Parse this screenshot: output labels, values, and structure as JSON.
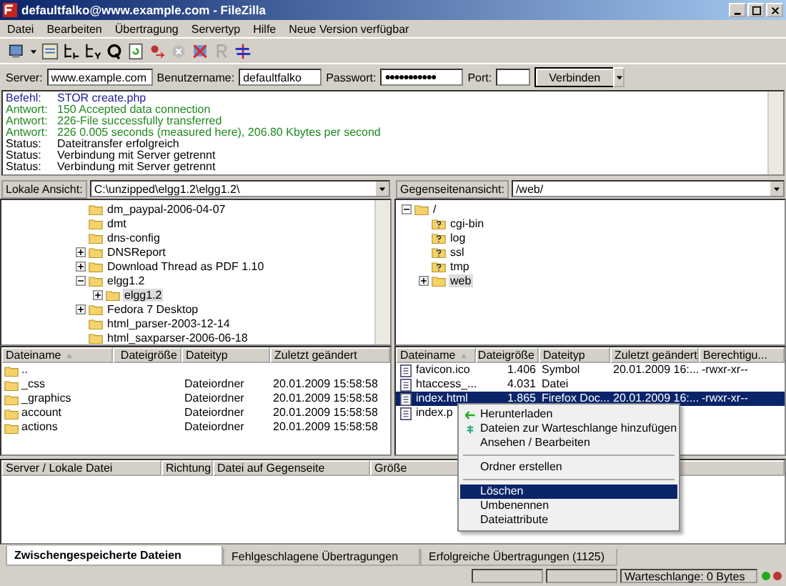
{
  "window": {
    "title": "defaultfalko@www.example.com - FileZilla"
  },
  "menu": [
    "Datei",
    "Bearbeiten",
    "Übertragung",
    "Servertyp",
    "Hilfe",
    "Neue Version verfügbar"
  ],
  "quickconnect": {
    "server_label": "Server:",
    "server": "www.example.com",
    "user_label": "Benutzername:",
    "user": "defaultfalko",
    "password_label": "Passwort:",
    "password": "●●●●●●●●●●●",
    "port_label": "Port:",
    "connect": "Verbinden"
  },
  "log": [
    {
      "kind": "command",
      "label": "Befehl:",
      "text": "STOR create.php"
    },
    {
      "kind": "response",
      "label": "Antwort:",
      "text": "150 Accepted data connection"
    },
    {
      "kind": "response",
      "label": "Antwort:",
      "text": "226-File successfully transferred"
    },
    {
      "kind": "response",
      "label": "Antwort:",
      "text": "226 0.005 seconds (measured here), 206.80 Kbytes per second"
    },
    {
      "kind": "status",
      "label": "Status:",
      "text": "Dateitransfer erfolgreich"
    },
    {
      "kind": "status",
      "label": "Status:",
      "text": "Verbindung mit Server getrennt"
    },
    {
      "kind": "status",
      "label": "Status:",
      "text": "Verbindung mit Server getrennt"
    }
  ],
  "local": {
    "path_label": "Lokale Ansicht:",
    "path": "C:\\unzipped\\elgg1.2\\elgg1.2\\",
    "tree": [
      {
        "name": "dm_paypal-2006-04-07",
        "kind": "folder",
        "selected": false
      },
      {
        "name": "dmt",
        "kind": "folder",
        "selected": false
      },
      {
        "name": "dns-config",
        "kind": "folder",
        "selected": false
      },
      {
        "name": "DNSReport",
        "kind": "folder",
        "selected": false,
        "expanded": false
      },
      {
        "name": "Download Thread as PDF 1.10",
        "kind": "folder",
        "selected": false,
        "expanded": false
      },
      {
        "name": "elgg1.2",
        "kind": "folder",
        "selected": false,
        "expanded": true,
        "children": [
          {
            "name": "elgg1.2",
            "kind": "folder",
            "selected": true,
            "expanded": false
          }
        ]
      },
      {
        "name": "Fedora 7 Desktop",
        "kind": "folder",
        "selected": false,
        "expanded": false
      },
      {
        "name": "html_parser-2003-12-14",
        "kind": "folder",
        "selected": false
      },
      {
        "name": "html_saxparser-2006-06-18",
        "kind": "folder",
        "selected": false
      }
    ],
    "columns": [
      "Dateiname",
      "Dateigröße",
      "Dateityp",
      "Zuletzt geändert"
    ],
    "rows": [
      {
        "name": "..",
        "size": "",
        "type": "",
        "modified": ""
      },
      {
        "name": "_css",
        "size": "",
        "type": "Dateiordner",
        "modified": "20.01.2009 15:58:58"
      },
      {
        "name": "_graphics",
        "size": "",
        "type": "Dateiordner",
        "modified": "20.01.2009 15:58:58"
      },
      {
        "name": "account",
        "size": "",
        "type": "Dateiordner",
        "modified": "20.01.2009 15:58:58"
      },
      {
        "name": "actions",
        "size": "",
        "type": "Dateiordner",
        "modified": "20.01.2009 15:58:58"
      }
    ]
  },
  "remote": {
    "path_label": "Gegenseitenansicht:",
    "path": "/web/",
    "tree": [
      {
        "name": "/",
        "kind": "folder",
        "selected": false,
        "expanded": true,
        "children": [
          {
            "name": "cgi-bin",
            "kind": "unknown",
            "selected": false
          },
          {
            "name": "log",
            "kind": "unknown",
            "selected": false
          },
          {
            "name": "ssl",
            "kind": "unknown",
            "selected": false
          },
          {
            "name": "tmp",
            "kind": "unknown",
            "selected": false
          },
          {
            "name": "web",
            "kind": "folder",
            "selected": true,
            "expanded": false
          }
        ]
      }
    ],
    "columns": [
      "Dateiname",
      "Dateigröße",
      "Dateityp",
      "Zuletzt geändert",
      "Berechtigu..."
    ],
    "rows": [
      {
        "name": "favicon.ico",
        "size": "1.406",
        "type": "Symbol",
        "modified": "20.01.2009 16:...",
        "perms": "-rwxr-xr--",
        "selected": false
      },
      {
        "name": "htaccess_...",
        "size": "4.031",
        "type": "Datei",
        "modified": "",
        "perms": "",
        "selected": false
      },
      {
        "name": "index.html",
        "size": "1.865",
        "type": "Firefox Doc...",
        "modified": "20.01.2009 16:...",
        "perms": "-rwxr-xr--",
        "selected": true
      },
      {
        "name": "index.p",
        "size": "",
        "type": "",
        "modified": "",
        "perms": "",
        "selected": false
      }
    ]
  },
  "context_menu": [
    {
      "kind": "item",
      "label": "Herunterladen",
      "selected": false
    },
    {
      "kind": "item",
      "label": "Dateien zur Warteschlange hinzufügen",
      "selected": false
    },
    {
      "kind": "item",
      "label": "Ansehen / Bearbeiten",
      "selected": false
    },
    {
      "kind": "separator"
    },
    {
      "kind": "item",
      "label": "Ordner erstellen",
      "selected": false
    },
    {
      "kind": "separator"
    },
    {
      "kind": "item",
      "label": "Löschen",
      "selected": true
    },
    {
      "kind": "item",
      "label": "Umbenennen",
      "selected": false
    },
    {
      "kind": "item",
      "label": "Dateiattribute",
      "selected": false
    }
  ],
  "queue": {
    "columns": [
      "Server / Lokale Datei",
      "Richtung",
      "Datei auf Gegenseite",
      "Größe"
    ]
  },
  "tabs": [
    {
      "label": "Zwischengespeicherte Dateien",
      "selected": true
    },
    {
      "label": "Fehlgeschlagene Übertragungen",
      "selected": false
    },
    {
      "label": "Erfolgreiche Übertragungen (1125)",
      "selected": false
    }
  ],
  "status_bar": {
    "queue": "Warteschlange: 0 Bytes"
  }
}
